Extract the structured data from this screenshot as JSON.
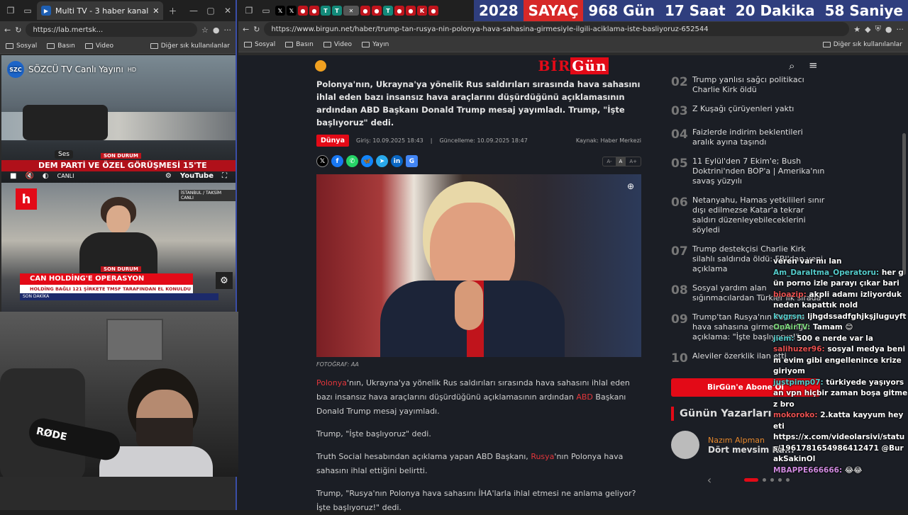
{
  "left_window": {
    "tab_title": "Multi TV - 3 haber kanal",
    "url": "https://lab.mertsk...",
    "bookmarks": [
      "Sosyal",
      "Basın",
      "Video",
      "Diğer sık kullanılanlar"
    ],
    "video1": {
      "channel": "SÖZCÜ TV Canlı Yayını",
      "hd": "HD",
      "tooltip": "Ses",
      "banner": "DEM PARTİ VE ÖZEL GÖRÜŞMESİ 15'TE",
      "live": "CANLI",
      "youtube": "YouTube",
      "tag": "SON DURUM"
    },
    "video2": {
      "tag": "SON DURUM",
      "headline": "CAN HOLDİNG'E OPERASYON",
      "subline": "HOLDİNG BAĞLI 121 ŞİRKETE TMSF TARAFINDAN EL KONULDU",
      "ticker": "SON DAKİKA",
      "live": "CANLI",
      "location": "İSTANBUL / TAKSİM"
    },
    "webcam_label": "RØDE"
  },
  "right_window": {
    "url": "https://www.birgun.net/haber/trump-tan-rusya-nin-polonya-hava-sahasina-girmesiyle-ilgili-aciklama-iste-basliyoruz-652544",
    "bookmarks": [
      "Sosyal",
      "Basın",
      "Video",
      "Yayın",
      "Diğer sık kullanılanlar"
    ],
    "counter": [
      "2028",
      "SAYAÇ",
      "968 Gün",
      "17 Saat",
      "20 Dakika",
      "58 Saniye"
    ]
  },
  "site": {
    "logo_a": "BİR",
    "logo_b": "Gün",
    "article": {
      "lead": "Polonya'nın, Ukrayna'ya yönelik Rus saldırıları sırasında hava sahasını ihlal eden bazı insansız hava araçlarını düşürdüğünü açıklamasının ardından ABD Başkanı Donald Trump mesaj yayımladı. Trump, \"İşte başlıyoruz\" dedi.",
      "category": "Dünya",
      "published": "Giriş: 10.09.2025 18:43",
      "updated": "Güncelleme: 10.09.2025 18:47",
      "source": "Kaynak: Haber Merkezi",
      "font_sizes": [
        "A-",
        "A",
        "A+"
      ],
      "photo_caption": "FOTOĞRAF: AA",
      "p1_a": "Polonya",
      "p1_b": "'nın, Ukrayna'ya yönelik Rus saldırıları sırasında hava sahasını ihlal eden bazı insansız hava araçlarını düşürdüğünü açıklamasının ardından ",
      "p1_c": "ABD",
      "p1_d": " Başkanı Donald Trump mesaj yayımladı.",
      "p2": "Trump, \"İşte başlıyoruz\" dedi.",
      "p3_a": "Truth Social hesabından açıklama yapan ABD Başkanı, ",
      "p3_b": "Rusya",
      "p3_c": "'nın Polonya hava sahasını ihlal ettiğini belirtti.",
      "p4": "Trump, \"Rusya'nın Polonya hava sahasını İHA'larla ihlal etmesi ne anlama geliyor? İşte başlıyoruz!\" dedi."
    },
    "most_read": [
      {
        "n": "02",
        "t": "Trump yanlısı sağcı politikacı Charlie Kirk öldü"
      },
      {
        "n": "03",
        "t": "Z Kuşağı çürüyenleri yaktı"
      },
      {
        "n": "04",
        "t": "Faizlerde indirim beklentileri aralık ayına taşındı"
      },
      {
        "n": "05",
        "t": "11 Eylül'den 7 Ekim'e; Bush Doktrini'nden BOP'a | Amerika'nın savaş yüzyılı"
      },
      {
        "n": "06",
        "t": "Netanyahu, Hamas yetkilileri sınır dışı edilmezse Katar'a tekrar saldırı düzenleyebileceklerini söyledi"
      },
      {
        "n": "07",
        "t": "Trump destekçisi Charlie Kirk silahlı saldırıda öldü: FBI'dan yeni açıklama"
      },
      {
        "n": "08",
        "t": "Sosyal yardım alan sığınmacılardan Türkler ilk sırada"
      },
      {
        "n": "09",
        "t": "Trump'tan Rusya'nın Polonya hava sahasına girmesiyle ilgili açıklama: \"İşte başlıyoruz!\""
      },
      {
        "n": "10",
        "t": "Aleviler özerklik ilan etti"
      }
    ],
    "subscribe": "BirGün'e Abone Ol",
    "writers_title": "Günün Yazarları",
    "writer_name": "Nazım Alpman",
    "writer_title": "Dört mevsim Ka..."
  },
  "chat": [
    {
      "u": "",
      "m": "veren var mı lan"
    },
    {
      "u": "Am_Daraltma_Operatoru:",
      "m": "her gün porno izle parayı çıkar bari"
    },
    {
      "u": "bioazip:",
      "m": "akpli adamı izliyorduk neden kapattık nold"
    },
    {
      "u": "kvgrsn:",
      "m": "ljhgdssadfghjkşjluguyft"
    },
    {
      "u": "OnAirTV:",
      "m": "Tamam 😊"
    },
    {
      "u": "jiem:",
      "m": "500 e nerde var la"
    },
    {
      "u": "salihuzer96:",
      "m": "sosyal medya benim evim gibi engellenince krize giriyom"
    },
    {
      "u": "justpimp07:",
      "m": "türkiyede yaşıyorsan vpn hiçbir zaman boşa gitmez bro"
    },
    {
      "u": "mokoroko:",
      "m": "2.katta kayyum heyeti"
    },
    {
      "u": "",
      "m": "https://x.com/videolarsivi/status/1961781654986412471 @BurakSakinOl"
    },
    {
      "u": "MBAPPE666666:",
      "m": "😂😂"
    }
  ],
  "colors": {
    "accent": "#e30a17",
    "counter_blue": "#2f3e7e"
  }
}
